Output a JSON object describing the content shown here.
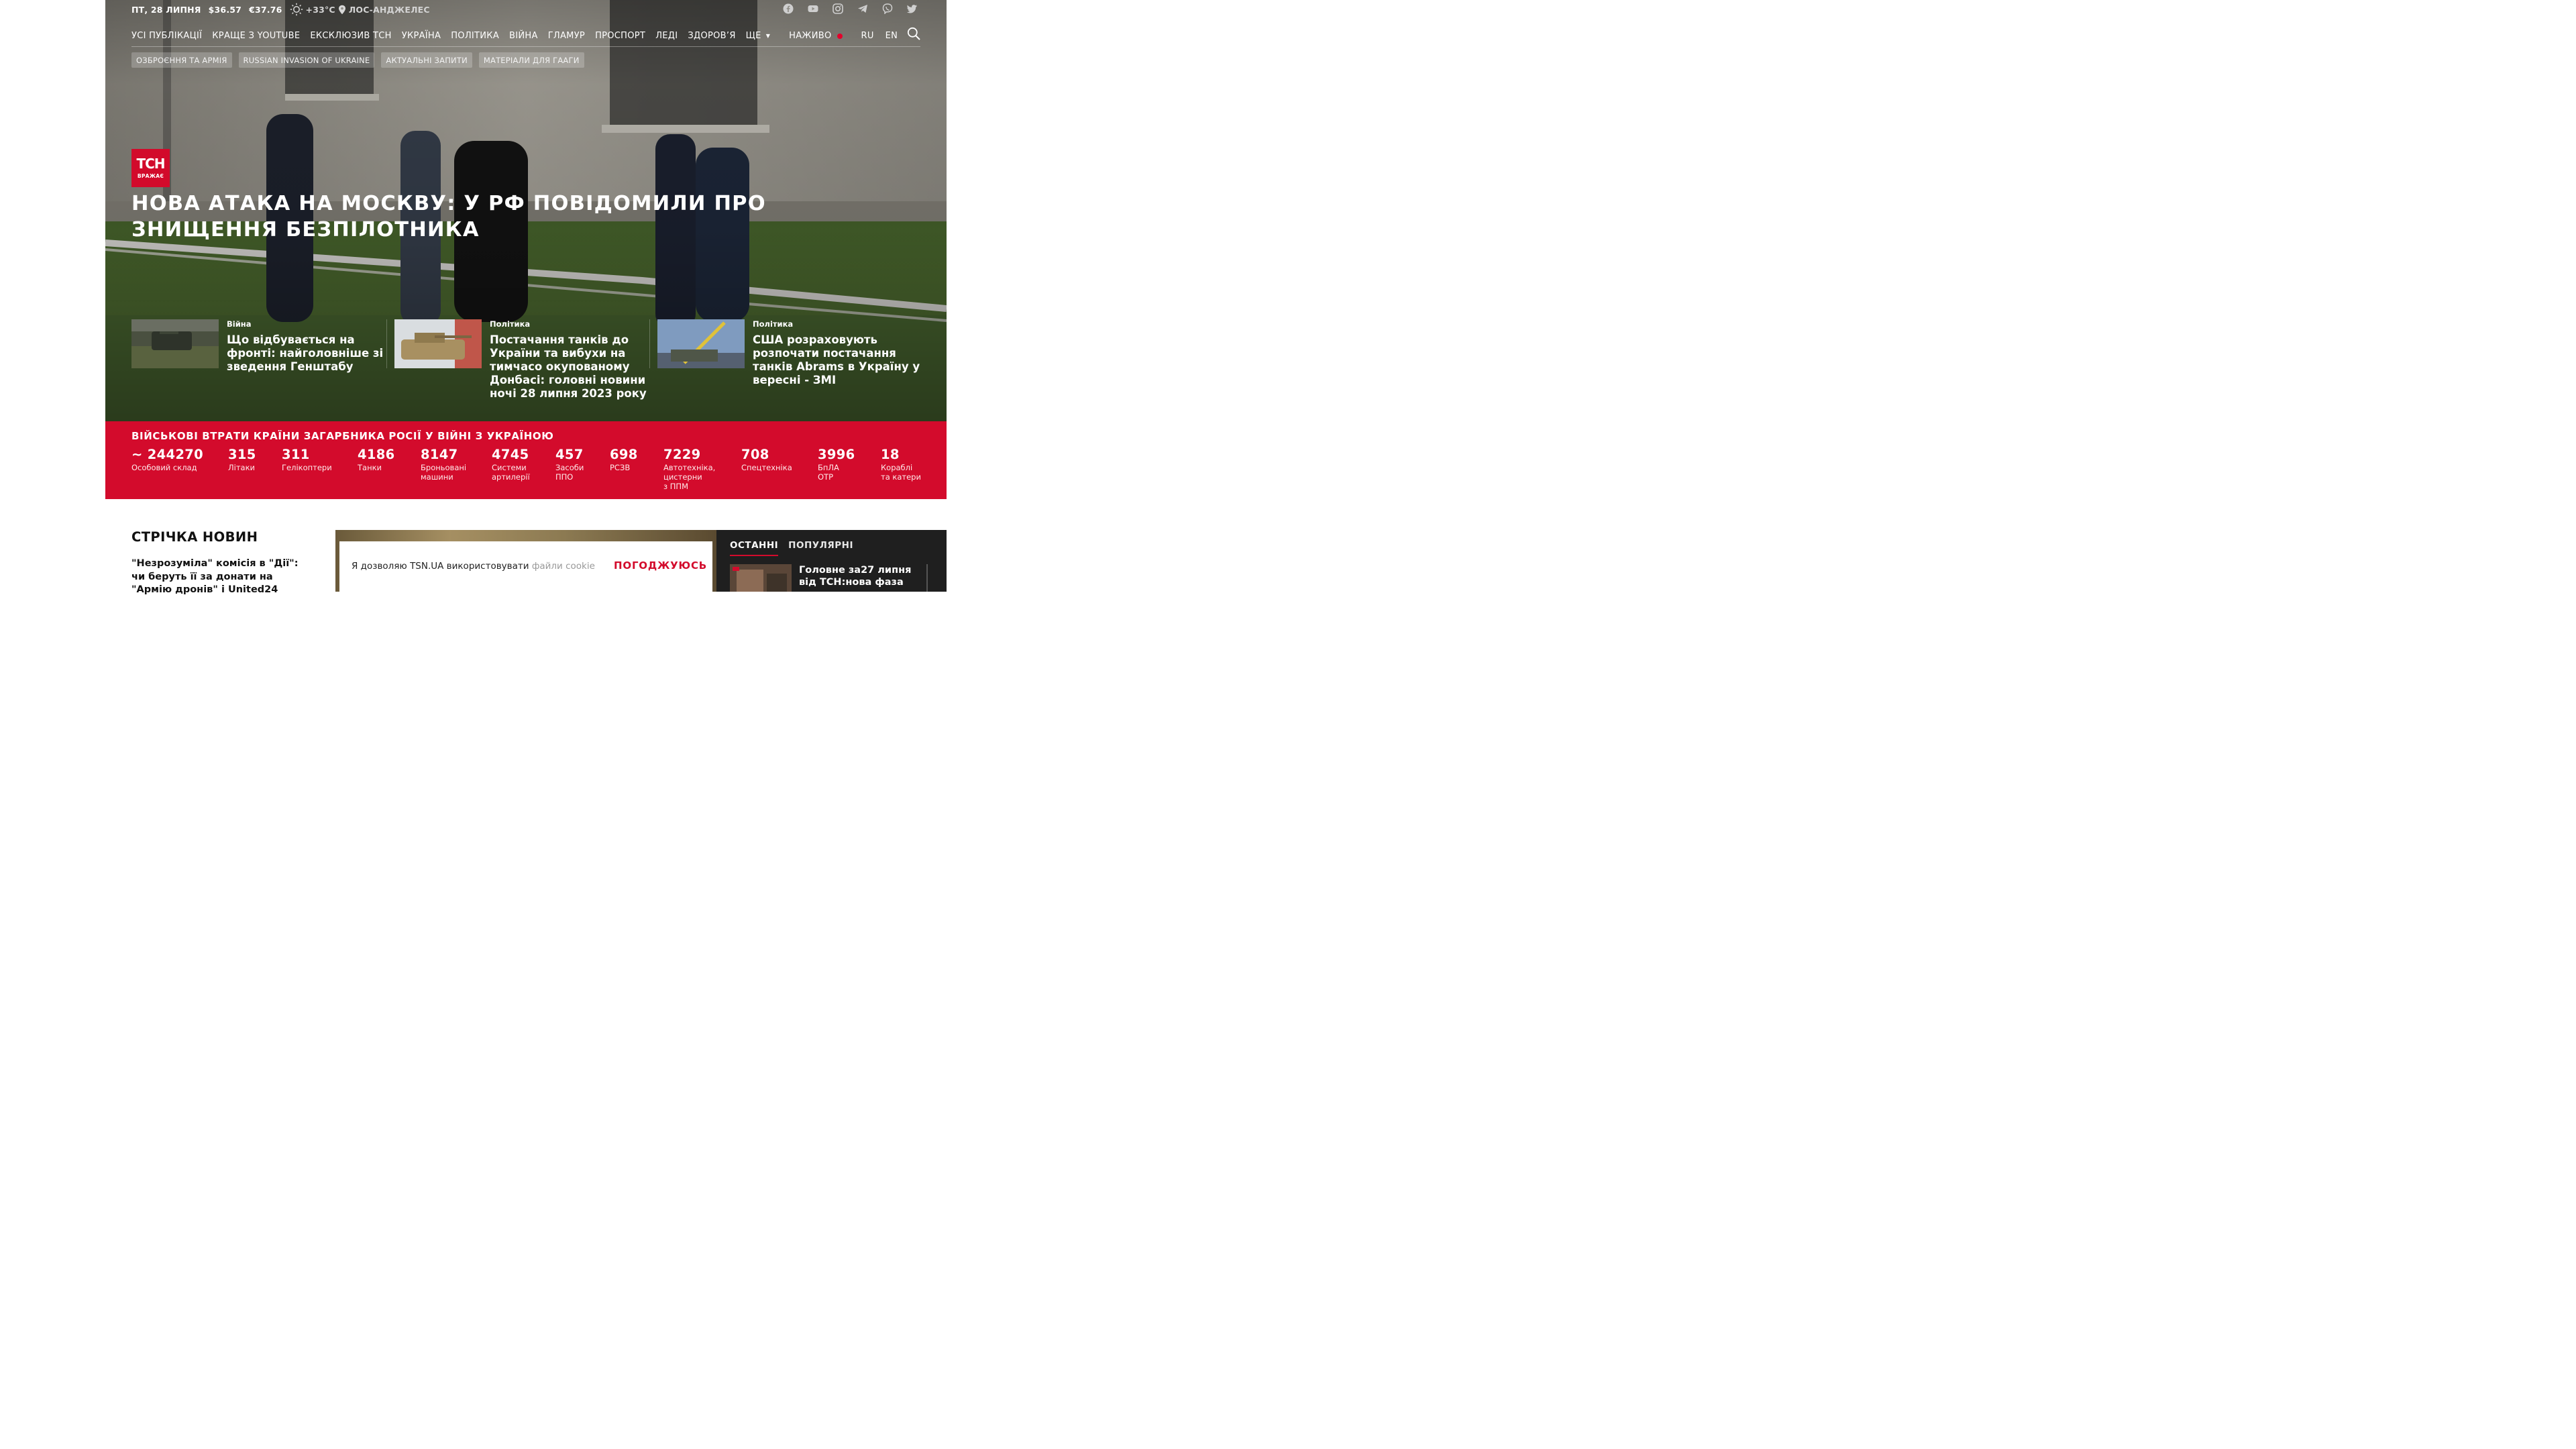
{
  "topbar": {
    "date": "ПТ, 28 ЛИПНЯ",
    "usd": "$36.57",
    "eur": "€37.76",
    "weather_temp": "+33°C",
    "city": "ЛОС-АНДЖЕЛЕС",
    "weather_icon": "sun-icon",
    "location_icon": "map-pin-icon"
  },
  "social": [
    "facebook-icon",
    "youtube-icon",
    "instagram-icon",
    "telegram-icon",
    "viber-icon",
    "twitter-icon"
  ],
  "nav": {
    "items": [
      "УСІ ПУБЛІКАЦІЇ",
      "КРАЩЕ З YOUTUBE",
      "ЕКСКЛЮЗИВ ТСН",
      "УКРАЇНА",
      "ПОЛІТИКА",
      "ВІЙНА",
      "ГЛАМУР",
      "ПРОСПОРТ",
      "ЛЕДІ",
      "ЗДОРОВ’Я"
    ],
    "more": "ЩЕ",
    "live": "НАЖИВО",
    "lang_ru": "RU",
    "lang_en": "EN"
  },
  "tags": [
    "ОЗБРОЄННЯ ТА АРМІЯ",
    "RUSSIAN INVASION OF UKRAINE",
    "АКТУАЛЬНІ ЗАПИТИ",
    "МАТЕРІАЛИ ДЛЯ ГААГИ"
  ],
  "hero": {
    "logo_main": "ТСН",
    "logo_sub": "ВРАЖАЄ",
    "headline": "Нова атака на Москву: у РФ повідомили про знищення безпілотника"
  },
  "cards": [
    {
      "category": "Війна",
      "title": "Що відбувається на фронті: найголовніше зі зведення Генштабу"
    },
    {
      "category": "Політика",
      "title": "Постачання танків до України та вибухи на тимчасо окупованому Донбасі: головні новини ночі 28 липня 2023 року"
    },
    {
      "category": "Політика",
      "title": "США розраховують розпочати постачання танків Abrams в Україну у вересні - ЗМІ"
    }
  ],
  "losses": {
    "heading": "ВІЙСЬКОВІ ВТРАТИ КРАЇНИ ЗАГАРБНИКА РОСІЇ У ВІЙНІ З УКРАЇНОЮ",
    "stats": [
      {
        "num": "~ 244270",
        "label": "Особовий склад"
      },
      {
        "num": "315",
        "label": "Літаки"
      },
      {
        "num": "311",
        "label": "Гелікоптери"
      },
      {
        "num": "4186",
        "label": "Танки"
      },
      {
        "num": "8147",
        "label": "Броньовані\nмашини"
      },
      {
        "num": "4745",
        "label": "Системи\nартилерії"
      },
      {
        "num": "457",
        "label": "Засоби\nППО"
      },
      {
        "num": "698",
        "label": "РСЗВ"
      },
      {
        "num": "7229",
        "label": "Автотехніка,\nцистерни\nз ППМ"
      },
      {
        "num": "708",
        "label": "Спецтехніка"
      },
      {
        "num": "3996",
        "label": "БпЛА\nОТР"
      },
      {
        "num": "18",
        "label": "Кораблі\nта катери"
      }
    ]
  },
  "feed": {
    "title": "СТРІЧКА НОВИН",
    "item": "\"Незрозуміла\" комісія в \"Дії\": чи беруть її за донати на \"Армію дронів\" і United24"
  },
  "cookie": {
    "text": "Я дозволяю TSN.UA використовувати",
    "link": "файли cookie",
    "accept": "ПОГОДЖУЮСЬ"
  },
  "sidebar": {
    "tab_latest": "ОСТАННІ",
    "tab_popular": "ПОПУЛЯРНІ",
    "item_title": "Головне за27 липня від ТСН:нова фаза"
  },
  "colors": {
    "brand_red": "#d30b2c",
    "dark": "#1f1f1f"
  }
}
